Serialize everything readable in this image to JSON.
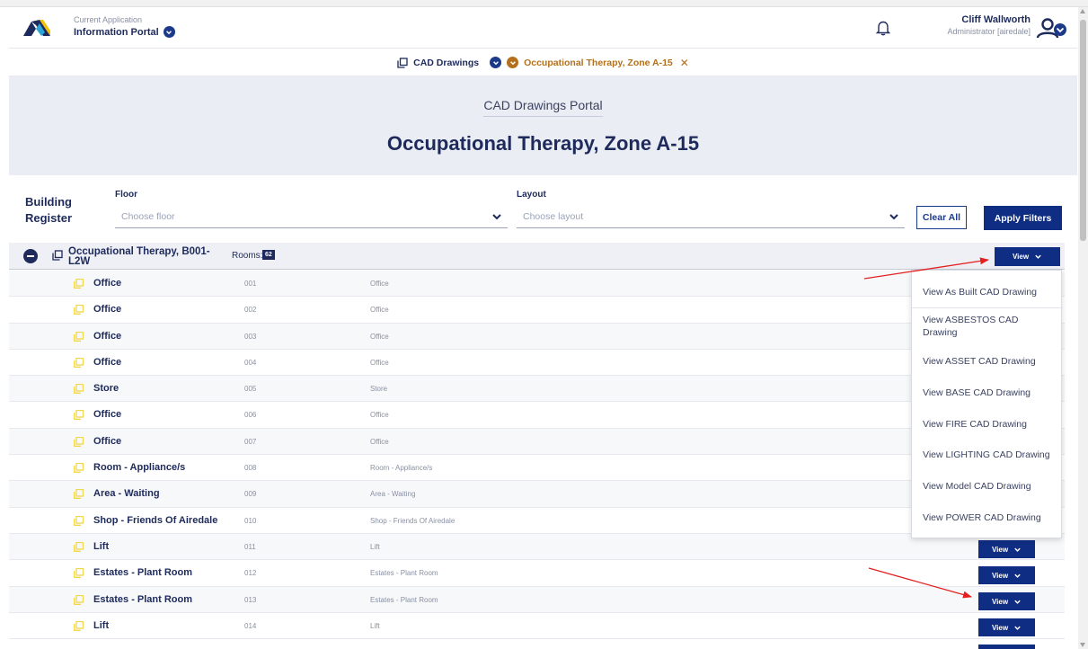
{
  "header": {
    "app_caption": "Current Application",
    "app_name": "Information Portal",
    "user_name": "Cliff Wallworth",
    "user_role": "Administrator [airedale]"
  },
  "breadcrumb": {
    "first": "CAD Drawings",
    "current": "Occupational Therapy, Zone A-15"
  },
  "hero": {
    "subtitle": "CAD Drawings Portal",
    "title": "Occupational Therapy, Zone A-15"
  },
  "filters": {
    "section_title_line1": "Building",
    "section_title_line2": "Register",
    "floor_label": "Floor",
    "floor_placeholder": "Choose floor",
    "layout_label": "Layout",
    "layout_placeholder": "Choose layout",
    "clear_label": "Clear All",
    "apply_label": "Apply Filters"
  },
  "group": {
    "name": "Occupational Therapy, B001-L2W",
    "rooms_label": "Rooms:",
    "rooms_count": "62",
    "view_label": "View"
  },
  "rooms": [
    {
      "name": "Office",
      "code": "001",
      "desc": "Office"
    },
    {
      "name": "Office",
      "code": "002",
      "desc": "Office"
    },
    {
      "name": "Office",
      "code": "003",
      "desc": "Office"
    },
    {
      "name": "Office",
      "code": "004",
      "desc": "Office"
    },
    {
      "name": "Store",
      "code": "005",
      "desc": "Store"
    },
    {
      "name": "Office",
      "code": "006",
      "desc": "Office"
    },
    {
      "name": "Office",
      "code": "007",
      "desc": "Office"
    },
    {
      "name": "Room - Appliance/s",
      "code": "008",
      "desc": "Room - Appliance/s"
    },
    {
      "name": "Area - Waiting",
      "code": "009",
      "desc": "Area - Waiting"
    },
    {
      "name": "Shop - Friends Of Airedale",
      "code": "010",
      "desc": "Shop - Friends Of Airedale"
    },
    {
      "name": "Lift",
      "code": "011",
      "desc": "Lift"
    },
    {
      "name": "Estates - Plant Room",
      "code": "012",
      "desc": "Estates - Plant Room"
    },
    {
      "name": "Estates - Plant Room",
      "code": "013",
      "desc": "Estates - Plant Room"
    },
    {
      "name": "Lift",
      "code": "014",
      "desc": "Lift"
    }
  ],
  "row_view_label": "View",
  "view_menu": [
    "View As Built CAD Drawing",
    "View ASBESTOS CAD Drawing",
    "View ASSET CAD Drawing",
    "View BASE CAD Drawing",
    "View FIRE CAD Drawing",
    "View LIGHTING CAD Drawing",
    "View Model CAD Drawing",
    "View POWER CAD Drawing"
  ],
  "colors": {
    "navy": "#1d2a5b",
    "button_blue": "#0f2d82",
    "accent_orange": "#b5701d",
    "folder_yellow": "#f2d64b",
    "annotation_red": "#e32020"
  }
}
